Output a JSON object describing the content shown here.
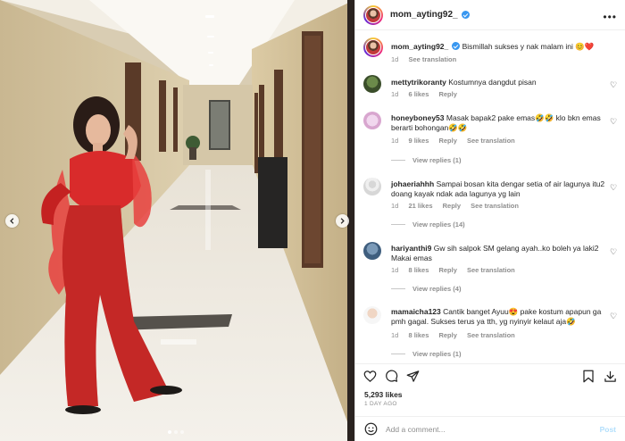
{
  "post": {
    "username": "mom_ayting92_",
    "more_icon": "more-horizontal-icon"
  },
  "caption": {
    "username": "mom_ayting92_",
    "text": "Bismillah sukses y nak malam ini 😊❤️",
    "time": "1d",
    "see_translation": "See translation"
  },
  "comments": [
    {
      "username": "mettytrikoranty",
      "text": "Kostumnya dangdut pisan",
      "time": "1d",
      "likes": "6 likes",
      "reply": "Reply",
      "see_translation": ""
    },
    {
      "username": "honeyboney53",
      "text": "Masak bapak2 pake emas🤣🤣 klo bkn emas berarti bohongan🤣🤣",
      "time": "1d",
      "likes": "9 likes",
      "reply": "Reply",
      "see_translation": "See translation",
      "view_replies": "View replies (1)"
    },
    {
      "username": "johaeriahhh",
      "text": "Sampai bosan kita dengar setia of air lagunya itu2 doang kayak ndak ada lagunya yg lain",
      "time": "1d",
      "likes": "21 likes",
      "reply": "Reply",
      "see_translation": "See translation",
      "view_replies": "View replies (14)"
    },
    {
      "username": "hariyanthi9",
      "text": "Gw sih salpok SM gelang ayah..ko boleh ya laki2 Makai emas",
      "time": "1d",
      "likes": "8 likes",
      "reply": "Reply",
      "see_translation": "See translation",
      "view_replies": "View replies (4)"
    },
    {
      "username": "mamaicha123",
      "text": "Cantik banget Ayuu😍 pake kostum apapun ga pmh gagal. Sukses terus ya tth, yg nyinyir kelaut aja🤣",
      "time": "1d",
      "likes": "8 likes",
      "reply": "Reply",
      "see_translation": "See translation",
      "view_replies": "View replies (1)"
    }
  ],
  "actions": {
    "likes": "5,293 likes",
    "date": "1 DAY AGO"
  },
  "add_comment": {
    "placeholder": "Add a comment...",
    "post_label": "Post"
  },
  "carousel": {
    "slides": 3,
    "active": 1
  },
  "colors": {
    "accent_blue": "#3897f0",
    "post_disabled": "#b2dffc",
    "heart_red": "#ed4956",
    "meta_gray": "#8e8e8e"
  }
}
